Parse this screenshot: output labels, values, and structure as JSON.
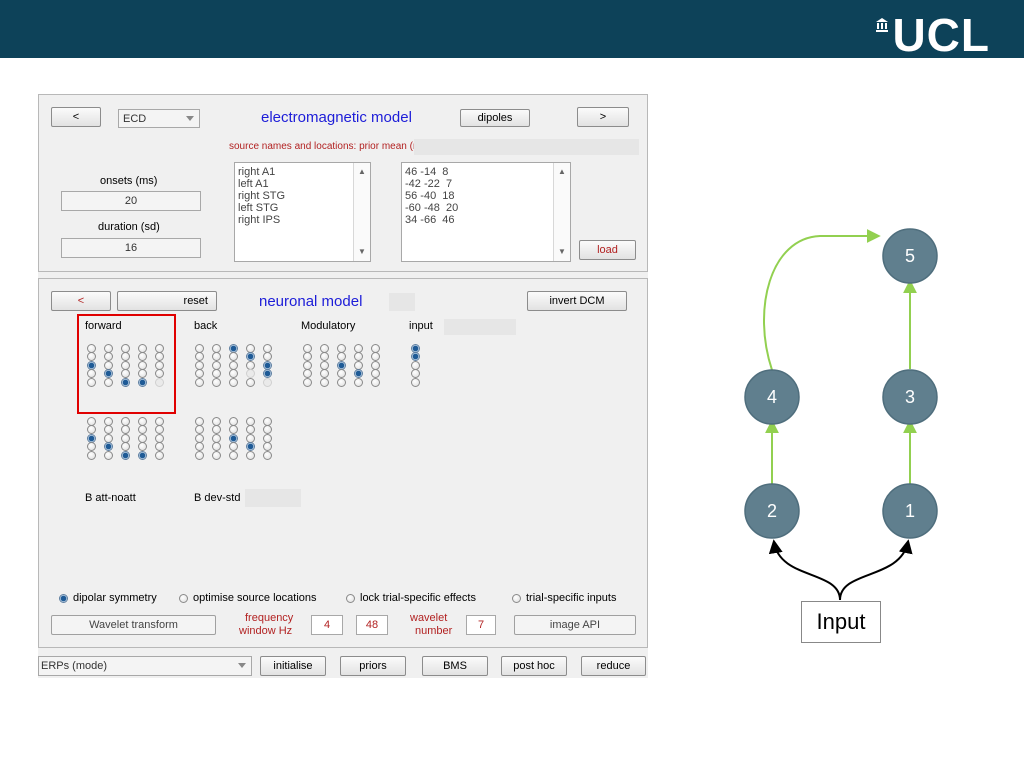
{
  "header": {
    "logo_text": "UCL",
    "bg_color": "#0d4259"
  },
  "em_panel": {
    "prev_button": "<",
    "next_button": ">",
    "model_type": "ECD",
    "title": "electromagnetic model",
    "dipoles_button": "dipoles",
    "source_heading": "source names and locations: prior mean (mm)",
    "onsets_label": "onsets (ms)",
    "onsets_value": "20",
    "duration_label": "duration (sd)",
    "duration_value": "16",
    "source_names": [
      "right A1",
      "left A1",
      "right STG",
      "left STG",
      "right IPS"
    ],
    "source_locations": [
      "46 -14  8",
      "-42 -22  7",
      "56 -40  18",
      "-60 -48  20",
      "34 -66  46"
    ],
    "load_button": "load"
  },
  "neuronal_panel": {
    "back_button": "<",
    "reset_button": "reset",
    "title": "neuronal model",
    "invert_button": "invert DCM",
    "col_forward": "forward",
    "col_back": "back",
    "col_modulatory": "Modulatory",
    "col_input": "input",
    "b_label_1": "B att-noatt",
    "b_label_2": "B dev-std",
    "grids": {
      "forward": [
        [
          0,
          0,
          0,
          0,
          0
        ],
        [
          0,
          0,
          0,
          0,
          0
        ],
        [
          1,
          0,
          0,
          0,
          0
        ],
        [
          0,
          1,
          0,
          0,
          0
        ],
        [
          0,
          0,
          1,
          1,
          2
        ]
      ],
      "back": [
        [
          0,
          0,
          1,
          0,
          0
        ],
        [
          0,
          0,
          0,
          1,
          0
        ],
        [
          0,
          0,
          0,
          0,
          1
        ],
        [
          0,
          0,
          0,
          2,
          1
        ],
        [
          0,
          0,
          0,
          0,
          2
        ]
      ],
      "modulatory": [
        [
          0,
          0,
          0,
          0,
          0
        ],
        [
          0,
          0,
          0,
          0,
          0
        ],
        [
          0,
          0,
          1,
          0,
          0
        ],
        [
          0,
          0,
          0,
          1,
          0
        ],
        [
          0,
          0,
          0,
          0,
          0
        ]
      ],
      "input": [
        [
          1
        ],
        [
          1
        ],
        [
          0
        ],
        [
          0
        ],
        [
          0
        ]
      ],
      "b1": [
        [
          0,
          0,
          0,
          0,
          0
        ],
        [
          0,
          0,
          0,
          0,
          0
        ],
        [
          1,
          0,
          0,
          0,
          0
        ],
        [
          0,
          1,
          0,
          0,
          0
        ],
        [
          0,
          0,
          1,
          1,
          0
        ]
      ],
      "b2": [
        [
          0,
          0,
          0,
          0,
          0
        ],
        [
          0,
          0,
          0,
          0,
          0
        ],
        [
          0,
          0,
          1,
          0,
          0
        ],
        [
          0,
          0,
          0,
          1,
          0
        ],
        [
          0,
          0,
          0,
          0,
          0
        ]
      ]
    }
  },
  "options": {
    "dipolar_symmetry": "dipolar symmetry",
    "optimise_locations": "optimise source locations",
    "lock_effects": "lock trial-specific effects",
    "trial_inputs": "trial-specific inputs",
    "wavelet_transform_button": "Wavelet transform",
    "frequency_label_1": "frequency",
    "frequency_label_2": "window Hz",
    "freq_low": "4",
    "freq_high": "48",
    "wavelet_label_1": "wavelet",
    "wavelet_label_2": "number",
    "wavelet_number": "7",
    "image_api_button": "image API"
  },
  "bottom_bar": {
    "mode_select": "ERPs (mode)",
    "initialise": "initialise",
    "priors": "priors",
    "bms": "BMS",
    "post_hoc": "post hoc",
    "reduce": "reduce"
  },
  "diagram": {
    "nodes": [
      "1",
      "2",
      "3",
      "4",
      "5"
    ],
    "input_label": "Input",
    "node_color": "#607f8e",
    "edge_color": "#92d050"
  }
}
